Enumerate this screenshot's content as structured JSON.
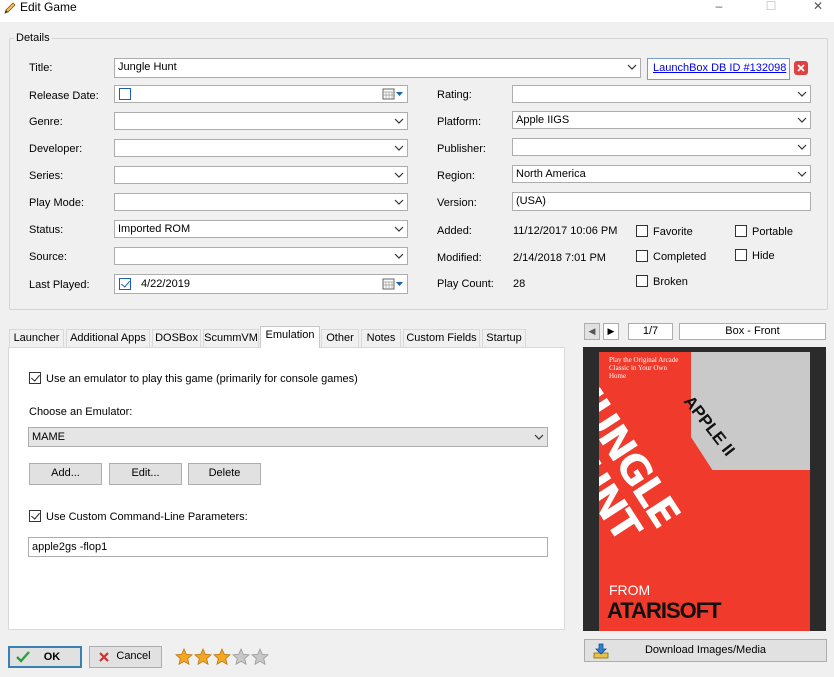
{
  "window": {
    "title": "Edit Game",
    "minimize_glyph": "–",
    "maximize_glyph": "☐",
    "close_glyph": "✕"
  },
  "details": {
    "group_label": "Details",
    "title": {
      "label": "Title:",
      "value": "Jungle Hunt"
    },
    "launchbox_link": "LaunchBox DB ID #132098",
    "release_date": {
      "label": "Release Date:",
      "value": ""
    },
    "genre": {
      "label": "Genre:",
      "value": ""
    },
    "developer": {
      "label": "Developer:",
      "value": ""
    },
    "series": {
      "label": "Series:",
      "value": ""
    },
    "play_mode": {
      "label": "Play Mode:",
      "value": ""
    },
    "status": {
      "label": "Status:",
      "value": "Imported ROM"
    },
    "source": {
      "label": "Source:",
      "value": ""
    },
    "last_played": {
      "label": "Last Played:",
      "value": "4/22/2019"
    },
    "rating": {
      "label": "Rating:",
      "value": ""
    },
    "platform": {
      "label": "Platform:",
      "value": "Apple IIGS"
    },
    "publisher": {
      "label": "Publisher:",
      "value": ""
    },
    "region": {
      "label": "Region:",
      "value": "North America"
    },
    "version": {
      "label": "Version:",
      "value": "(USA)"
    },
    "added": {
      "label": "Added:",
      "value": "11/12/2017 10:06 PM"
    },
    "modified": {
      "label": "Modified:",
      "value": "2/14/2018 7:01 PM"
    },
    "play_count": {
      "label": "Play Count:",
      "value": "28"
    },
    "checkboxes": {
      "favorite": {
        "label": "Favorite",
        "checked": false
      },
      "portable": {
        "label": "Portable",
        "checked": false
      },
      "completed": {
        "label": "Completed",
        "checked": false
      },
      "hide": {
        "label": "Hide",
        "checked": false
      },
      "broken": {
        "label": "Broken",
        "checked": false
      }
    }
  },
  "tabs": [
    "Launcher",
    "Additional Apps",
    "DOSBox",
    "ScummVM",
    "Emulation",
    "Other",
    "Notes",
    "Custom Fields",
    "Startup"
  ],
  "active_tab": "Emulation",
  "emulation": {
    "use_emulator_label": "Use an emulator to play this game (primarily for console games)",
    "use_emulator_checked": true,
    "choose_label": "Choose an Emulator:",
    "emulator_value": "MAME",
    "add_button": "Add...",
    "edit_button": "Edit...",
    "delete_button": "Delete",
    "custom_params_label": "Use Custom Command-Line Parameters:",
    "custom_params_checked": true,
    "params_value": "apple2gs -flop1"
  },
  "image_panel": {
    "prev_glyph": "◀",
    "next_glyph": "▶",
    "counter": "1/7",
    "image_type": "Box - Front",
    "download_button": "Download Images/Media",
    "cover": {
      "tagline": "Play the Original Arcade Classic in Your Own Home",
      "platform_banner": "APPLE II",
      "title_line1": "JUNGLE",
      "title_line2": "HUNT",
      "from_text": "FROM",
      "publisher_logo": "ATARISOFT",
      "background_color": "#ef3a2c"
    }
  },
  "footer": {
    "ok_button": "OK",
    "cancel_button": "Cancel",
    "rating_stars": 3,
    "rating_max": 5
  },
  "colors": {
    "accent_link": "#0000ee",
    "close_red": "#e04040",
    "ok_check": "#2e9e3e",
    "star_filled": "#f5a623",
    "star_empty": "#c8c8c8"
  }
}
